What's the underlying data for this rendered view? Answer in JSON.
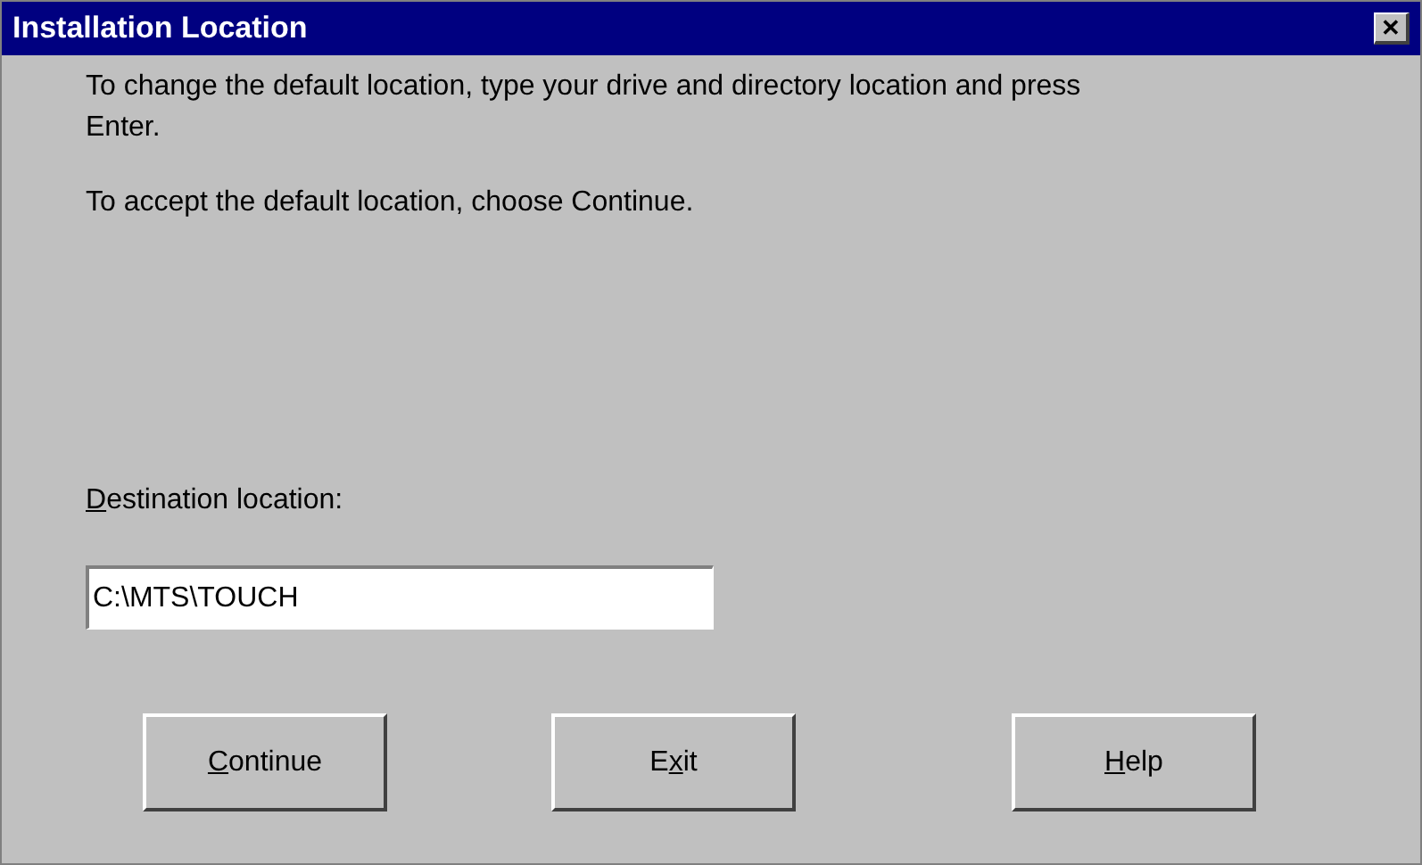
{
  "window": {
    "title": "Installation Location",
    "close": "✕"
  },
  "instructions": [
    "To change the default location, type your drive and directory location and press Enter.",
    "To accept the default location, choose Continue."
  ],
  "destination": {
    "label": {
      "key": "D",
      "after": "estination location:"
    },
    "value": "C:\\MTS\\TOUCH"
  },
  "buttons": [
    {
      "key": "C",
      "after": "ontinue"
    },
    {
      "before": "E",
      "key": "x",
      "after": "it"
    },
    {
      "key": "H",
      "after": "elp"
    }
  ]
}
